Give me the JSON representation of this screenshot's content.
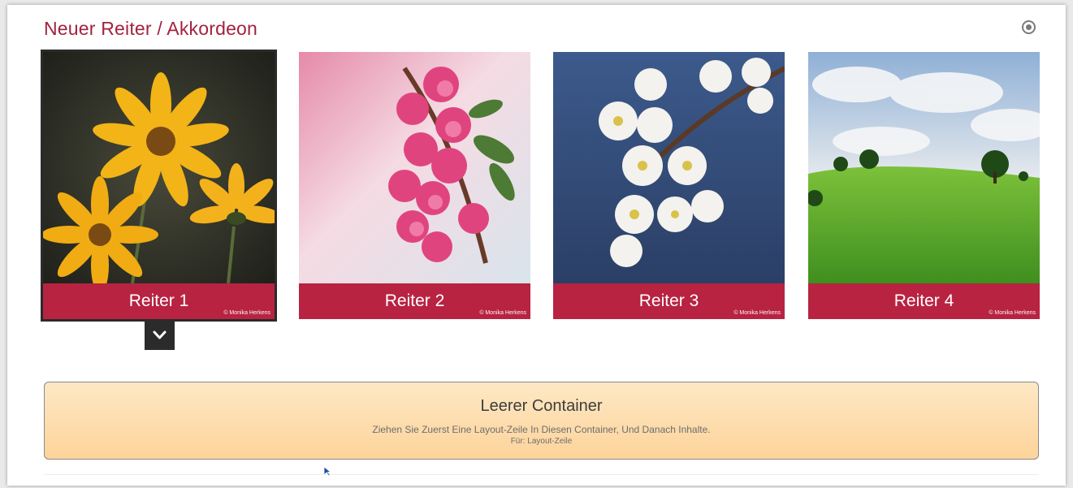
{
  "header": {
    "title": "Neuer Reiter / Akkordeon",
    "settings_icon": "gear-icon"
  },
  "tabs": [
    {
      "label": "Reiter 1",
      "credit": "© Monika Herkens",
      "image": "yellow flowers",
      "active": true
    },
    {
      "label": "Reiter 2",
      "credit": "© Monika Herkens",
      "image": "pink blossoms",
      "active": false
    },
    {
      "label": "Reiter 3",
      "credit": "© Monika Herkens",
      "image": "white cherry blossoms",
      "active": false
    },
    {
      "label": "Reiter 4",
      "credit": "© Monika Herkens",
      "image": "green meadow with trees",
      "active": false
    }
  ],
  "expand_icon": "chevron-down-icon",
  "empty_container": {
    "title": "Leerer Container",
    "description": "Ziehen Sie Zuerst Eine Layout-Zeile In Diesen Container, Und Danach Inhalte.",
    "for_label": "Für: Layout-Zeile"
  },
  "colors": {
    "accent": "#b82342",
    "title": "#a3223f",
    "container_bg_top": "#fde8c4",
    "container_bg_bottom": "#fdd39a"
  }
}
